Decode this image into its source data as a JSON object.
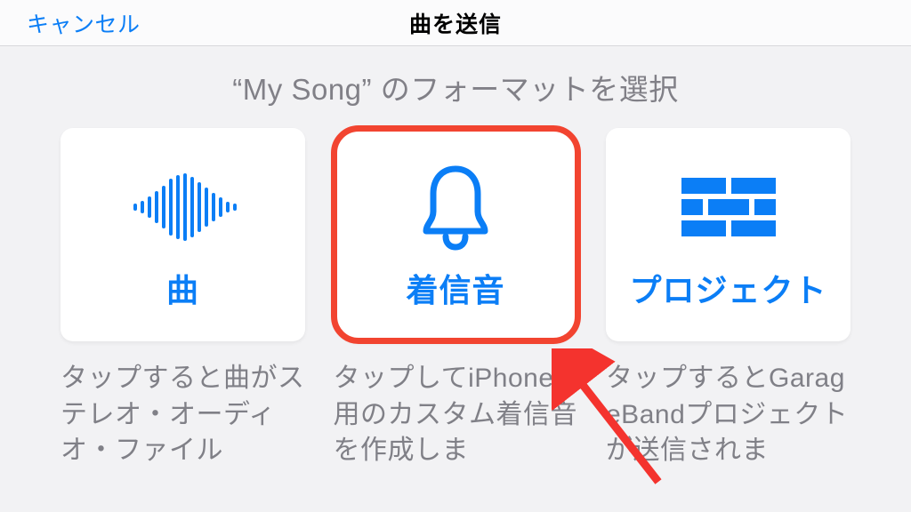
{
  "header": {
    "cancel": "キャンセル",
    "title": "曲を送信"
  },
  "subtitle": {
    "song_name": "My Song",
    "suffix": " のフォーマットを選択"
  },
  "options": [
    {
      "key": "song",
      "label": "曲",
      "description": "タップすると曲がステレオ・オーディオ・ファイル",
      "icon": "waveform-icon",
      "highlighted": false
    },
    {
      "key": "ringtone",
      "label": "着信音",
      "description": "タップしてiPhone用のカスタム着信音を作成しま",
      "icon": "bell-icon",
      "highlighted": true
    },
    {
      "key": "project",
      "label": "プロジェクト",
      "description": "タップするとGarageBandプロジェクトが送信されま",
      "icon": "bricks-icon",
      "highlighted": false
    }
  ],
  "colors": {
    "accent": "#0b7ef6",
    "highlight": "#f24430",
    "muted": "#808087"
  }
}
